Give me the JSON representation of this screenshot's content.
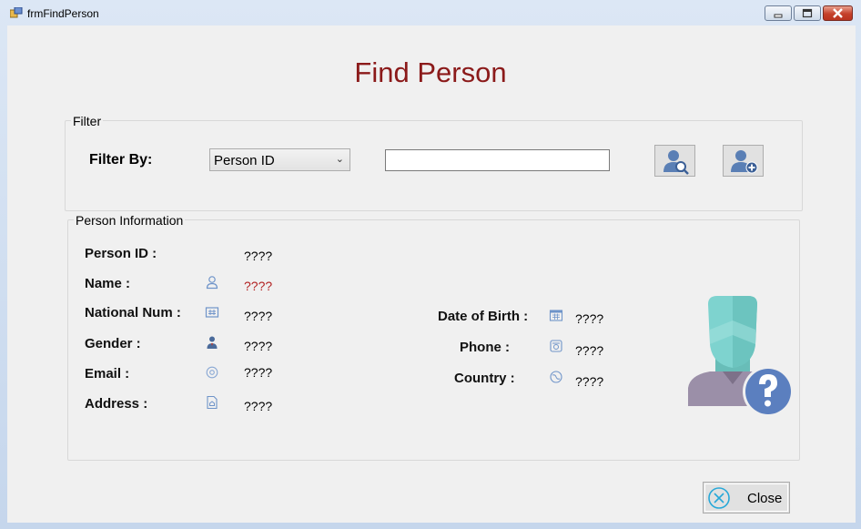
{
  "window": {
    "title": "frmFindPerson"
  },
  "form": {
    "heading": "Find Person"
  },
  "filter": {
    "group_label": "Filter",
    "filter_by_label": "Filter By:",
    "selected_option": "Person ID",
    "input_value": "",
    "search_button_icon": "person-search-icon",
    "add_button_icon": "person-add-icon"
  },
  "person_info": {
    "group_label": "Person Information",
    "fields": {
      "person_id": {
        "label": "Person ID :",
        "value": "????"
      },
      "name": {
        "label": "Name :",
        "value": "????"
      },
      "national_num": {
        "label": "National Num :",
        "value": "????"
      },
      "gender": {
        "label": "Gender :",
        "value": "????"
      },
      "email": {
        "label": "Email :",
        "value": "????"
      },
      "address": {
        "label": "Address :",
        "value": "????"
      },
      "date_of_birth": {
        "label": "Date of Birth :",
        "value": "????"
      },
      "phone": {
        "label": "Phone :",
        "value": "????"
      },
      "country": {
        "label": "Country :",
        "value": "????"
      }
    },
    "picture": "unknown-person-avatar"
  },
  "close_button": {
    "label": "Close"
  },
  "colors": {
    "heading": "#8b1a1a",
    "name_value": "#b22222",
    "avatar_teal": "#7ed3cf",
    "badge_blue": "#5b7fbf"
  }
}
